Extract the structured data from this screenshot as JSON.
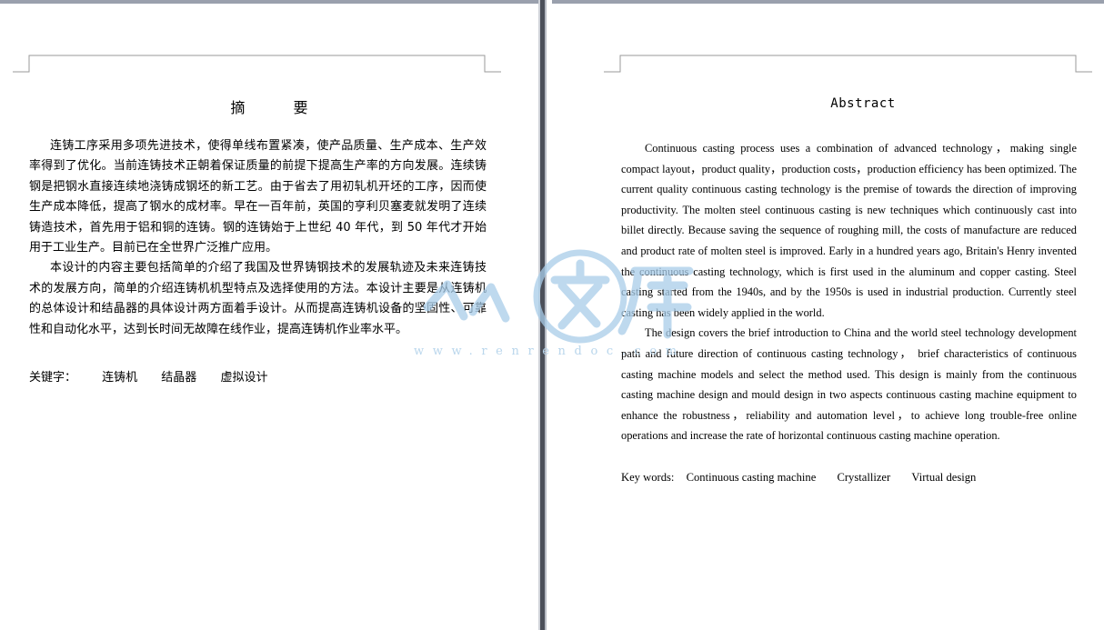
{
  "left_page": {
    "title": "摘 要",
    "paragraphs": [
      "连铸工序采用多项先进技术，使得单线布置紧凑，使产品质量、生产成本、生产效率得到了优化。当前连铸技术正朝着保证质量的前提下提高生产率的方向发展。连续铸钢是把钢水直接连续地浇铸成钢坯的新工艺。由于省去了用初轧机开坯的工序，因而使生产成本降低，提高了钢水的成材率。早在一百年前，英国的亨利贝塞麦就发明了连续铸造技术，首先用于铝和铜的连铸。钢的连铸始于上世纪 40 年代，到 50 年代才开始用于工业生产。目前已在全世界广泛推广应用。",
      "本设计的内容主要包括简单的介绍了我国及世界铸钢技术的发展轨迹及未来连铸技术的发展方向，简单的介绍连铸机机型特点及选择使用的方法。本设计主要是从连铸机的总体设计和结晶器的具体设计两方面着手设计。从而提高连铸机设备的坚固性、可靠性和自动化水平，达到长时间无故障在线作业，提高连铸机作业率水平。"
    ],
    "keywords_label": "关键字：",
    "keywords": [
      "连铸机",
      "结晶器",
      "虚拟设计"
    ]
  },
  "right_page": {
    "title": "Abstract",
    "paragraphs": [
      "Continuous casting process uses a combination of advanced technology，making single compact layout，product quality，production costs，production efficiency has been optimized. The current quality continuous casting technology is the premise of towards the direction of improving productivity. The molten steel continuous casting is new techniques which continuously cast into billet directly. Because saving the sequence of roughing mill, the costs of manufacture are reduced and product rate of molten steel is improved. Early in a hundred years ago, Britain's Henry invented the continuous casting technology, which is first used in the aluminum and copper casting. Steel casting started from the 1940s, and by the 1950s is used in industrial production. Currently steel casting has been widely applied in the world.",
      "The design covers the brief introduction to China and the world steel technology development path and future direction of continuous casting technology， brief characteristics of continuous casting machine models and select the method used. This design is mainly from the continuous casting machine design and mould design in two aspects continuous casting machine equipment to enhance the robustness，reliability and automation level，to achieve long trouble-free online operations and increase the rate of horizontal continuous casting machine operation."
    ],
    "keywords_label": "Key words:",
    "keywords": [
      "Continuous casting machine",
      "Crystallizer",
      "Virtual design"
    ]
  },
  "watermark": {
    "text": "www.renrendoc.com",
    "color": "#a9cde9"
  }
}
